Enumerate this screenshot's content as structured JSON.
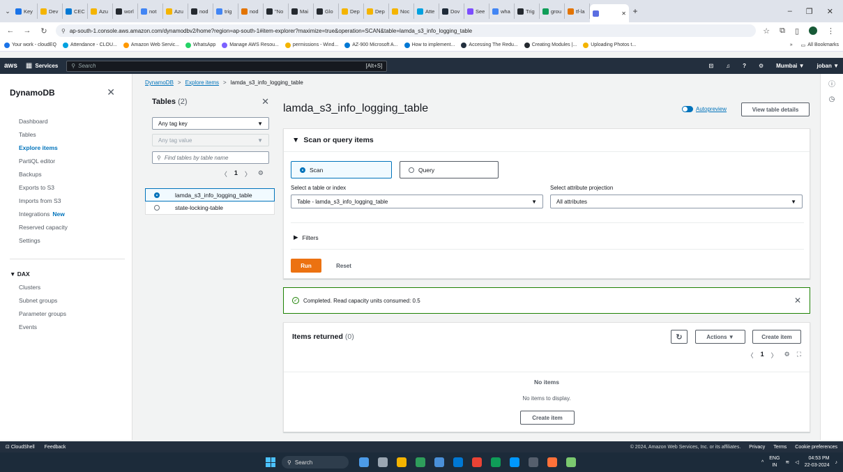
{
  "browser": {
    "tabs": [
      {
        "label": "Key",
        "color": "#1a73e8"
      },
      {
        "label": "Dev",
        "color": "#f4b400"
      },
      {
        "label": "CEC",
        "color": "#0078d4"
      },
      {
        "label": "Azu",
        "color": "#f4b400"
      },
      {
        "label": "worl",
        "color": "#24292f"
      },
      {
        "label": "not",
        "color": "#4285f4"
      },
      {
        "label": "Azu",
        "color": "#f4b400"
      },
      {
        "label": "nod",
        "color": "#24292f"
      },
      {
        "label": "trig",
        "color": "#4285f4"
      },
      {
        "label": "nod",
        "color": "#e37400"
      },
      {
        "label": "\"No",
        "color": "#24292f"
      },
      {
        "label": "Mai",
        "color": "#24292f"
      },
      {
        "label": "Glo",
        "color": "#24292f"
      },
      {
        "label": "Dep",
        "color": "#f4b400"
      },
      {
        "label": "Dep",
        "color": "#f4b400"
      },
      {
        "label": "Noc",
        "color": "#f4b400"
      },
      {
        "label": "Atte",
        "color": "#00a1e0"
      },
      {
        "label": "Dov",
        "color": "#1e2a38"
      },
      {
        "label": "See",
        "color": "#7c4dff"
      },
      {
        "label": "wha",
        "color": "#4285f4"
      },
      {
        "label": "Trig",
        "color": "#24292f"
      },
      {
        "label": "grou",
        "color": "#0f9d58"
      },
      {
        "label": "tf-la",
        "color": "#e37400"
      }
    ],
    "active_tab_color": "#5b6ee1",
    "new_tab": "+",
    "window_controls": [
      "–",
      "❐",
      "✕"
    ],
    "url": "ap-south-1.console.aws.amazon.com/dynamodbv2/home?region=ap-south-1#item-explorer?maximize=true&operation=SCAN&table=lamda_s3_info_logging_table",
    "bookmarks": [
      {
        "label": "Your work - cloudEQ",
        "color": "#1a73e8"
      },
      {
        "label": "Attendance - CLOU...",
        "color": "#00a1e0"
      },
      {
        "label": "Amazon Web Servic...",
        "color": "#ff9900"
      },
      {
        "label": "WhatsApp",
        "color": "#25d366"
      },
      {
        "label": "Manage AWS Resou...",
        "color": "#7b61ff"
      },
      {
        "label": "permissions - Wind...",
        "color": "#f4b400"
      },
      {
        "label": "AZ-900 Microsoft A...",
        "color": "#0078d4"
      },
      {
        "label": "How to implement...",
        "color": "#0078d4"
      },
      {
        "label": "Accessing The Redu...",
        "color": "#232f3e"
      },
      {
        "label": "Creating Modules |...",
        "color": "#24292f"
      },
      {
        "label": "Uploading Photos t...",
        "color": "#f4b400"
      }
    ],
    "bookmarks_more": "»",
    "all_bookmarks": "All Bookmarks"
  },
  "aws_nav": {
    "logo": "aws",
    "services": "Services",
    "search_placeholder": "Search",
    "search_shortcut": "[Alt+S]",
    "region": "Mumbai ▼",
    "user": "joban ▼"
  },
  "sidebar": {
    "title": "DynamoDB",
    "items": [
      {
        "label": "Dashboard",
        "active": false
      },
      {
        "label": "Tables",
        "active": false
      },
      {
        "label": "Explore items",
        "active": true
      },
      {
        "label": "PartiQL editor",
        "active": false
      },
      {
        "label": "Backups",
        "active": false
      },
      {
        "label": "Exports to S3",
        "active": false
      },
      {
        "label": "Imports from S3",
        "active": false
      },
      {
        "label": "Integrations",
        "active": false,
        "badge": "New"
      },
      {
        "label": "Reserved capacity",
        "active": false
      },
      {
        "label": "Settings",
        "active": false
      }
    ],
    "dax_group": "▼ DAX",
    "dax_items": [
      "Clusters",
      "Subnet groups",
      "Parameter groups",
      "Events"
    ]
  },
  "breadcrumb": {
    "items": [
      "DynamoDB",
      "Explore items"
    ],
    "current": "lamda_s3_info_logging_table",
    "separator": ">"
  },
  "tables_panel": {
    "title": "Tables",
    "count": "(2)",
    "tag_key": "Any tag key",
    "tag_value": "Any tag value",
    "search_placeholder": "Find tables by table name",
    "page": "1",
    "rows": [
      {
        "name": "lamda_s3_info_logging_table",
        "selected": true
      },
      {
        "name": "state-locking-table",
        "selected": false
      }
    ]
  },
  "main": {
    "title": "lamda_s3_info_logging_table",
    "autopreview": "Autopreview",
    "view_details": "View table details",
    "scan_section": {
      "heading": "Scan or query items",
      "scan_label": "Scan",
      "query_label": "Query",
      "table_label": "Select a table or index",
      "table_value": "Table - lamda_s3_info_logging_table",
      "projection_label": "Select attribute projection",
      "projection_value": "All attributes",
      "filters": "Filters",
      "run": "Run",
      "reset": "Reset"
    },
    "success_message": "Completed. Read capacity units consumed: 0.5",
    "items": {
      "heading": "Items returned",
      "count": "(0)",
      "actions": "Actions ▼",
      "create_item": "Create item",
      "page": "1",
      "empty_title": "No items",
      "empty_sub": "No items to display.",
      "empty_button": "Create item"
    }
  },
  "footer": {
    "cloudshell": "CloudShell",
    "feedback": "Feedback",
    "copyright": "© 2024, Amazon Web Services, Inc. or its affiliates.",
    "privacy": "Privacy",
    "terms": "Terms",
    "cookies": "Cookie preferences"
  },
  "taskbar": {
    "search": "Search",
    "apps": [
      {
        "name": "widgets",
        "color": "#4c9be8"
      },
      {
        "name": "settings",
        "color": "#9aa6b2"
      },
      {
        "name": "file-explorer",
        "color": "#f4b400"
      },
      {
        "name": "app-green",
        "color": "#2e9e5b"
      },
      {
        "name": "app-blue",
        "color": "#4a90d9"
      },
      {
        "name": "app-outlook",
        "color": "#0078d4"
      },
      {
        "name": "chrome",
        "color": "#ea4335"
      },
      {
        "name": "app-folder",
        "color": "#0f9d58"
      },
      {
        "name": "vscode",
        "color": "#0098ff"
      },
      {
        "name": "terminal",
        "color": "#555f6d"
      },
      {
        "name": "firefox",
        "color": "#ff7139"
      },
      {
        "name": "app-image",
        "color": "#7bc96f"
      }
    ],
    "lang_top": "ENG",
    "lang_bottom": "IN",
    "time": "04:53 PM",
    "date": "22-03-2024"
  }
}
